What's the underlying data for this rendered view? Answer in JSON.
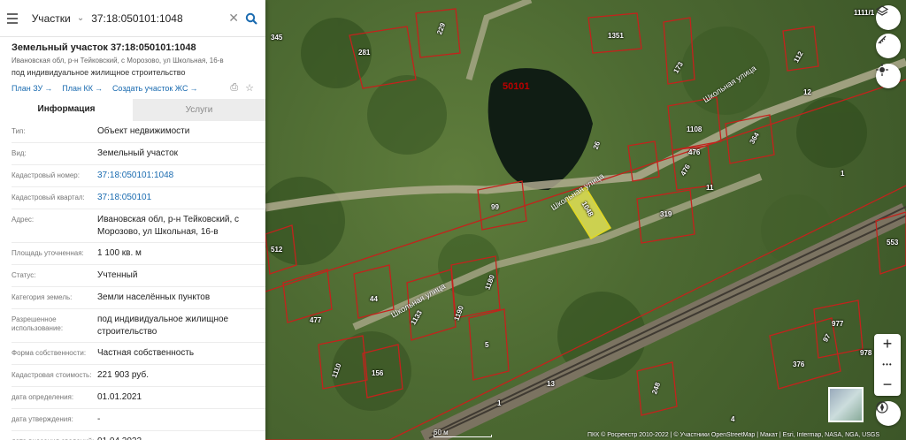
{
  "search": {
    "type_label": "Участки",
    "query": "37:18:050101:1048"
  },
  "object": {
    "title": "Земельный участок 37:18:050101:1048",
    "address_short": "Ивановская обл, р-н Тейковский, с Морозово, ул Школьная, 16-в",
    "usage": "под индивидуальное жилищное строительство",
    "links": [
      "План ЗУ",
      "План КК",
      "Создать участок ЖС"
    ]
  },
  "tabs": [
    "Информация",
    "Услуги"
  ],
  "properties": [
    {
      "key": "Тип:",
      "value": "Объект недвижимости"
    },
    {
      "key": "Вид:",
      "value": "Земельный участок"
    },
    {
      "key": "Кадастровый номер:",
      "value": "37:18:050101:1048"
    },
    {
      "key": "Кадастровый квартал:",
      "value": "37:18:050101"
    },
    {
      "key": "Адрес:",
      "value": "Ивановская обл, р-н Тейковский, с Морозово, ул Школьная, 16-в"
    },
    {
      "key": "Площадь уточненная:",
      "value": "1 100 кв. м"
    },
    {
      "key": "Статус:",
      "value": "Учтенный"
    },
    {
      "key": "Категория земель:",
      "value": "Земли населённых пунктов"
    },
    {
      "key": "Разрешенное использование:",
      "value": "под индивидуальное жилищное строительство"
    },
    {
      "key": "Форма собственности:",
      "value": "Частная собственность"
    },
    {
      "key": "Кадастровая стоимость:",
      "value": "221 903 руб."
    },
    {
      "key": "дата определения:",
      "value": "01.01.2021"
    },
    {
      "key": "дата утверждения:",
      "value": "-"
    },
    {
      "key": "дата внесения сведений:",
      "value": "01.04.2022"
    }
  ],
  "map": {
    "quarter_label": "50101",
    "streets": [
      "Школьная улица",
      "Школьная улица",
      "Школьная улица"
    ],
    "parcel_numbers": [
      "281",
      "229",
      "1351",
      "1111/1",
      "173",
      "112",
      "12",
      "1108",
      "476",
      "476",
      "364",
      "11",
      "1",
      "26",
      "99",
      "1048",
      "319",
      "512",
      "1180",
      "44",
      "477",
      "1133",
      "1190",
      "5",
      "553",
      "97",
      "376",
      "977",
      "978",
      "156",
      "1110",
      "13",
      "248",
      "1",
      "4",
      "345",
      "1048"
    ],
    "scale_label": "60 м",
    "attribution": "ПКК © Росреестр 2010-2022 | © Участники OpenStreetMap | Макат | Esri, Intermap, NASA, NGA, USGS",
    "zoom_in": "+",
    "zoom_more": "•••",
    "zoom_out": "−",
    "colors": {
      "boundary": "#c4221c",
      "selected_fill": "#f5f15a",
      "water": "#101d14"
    }
  }
}
